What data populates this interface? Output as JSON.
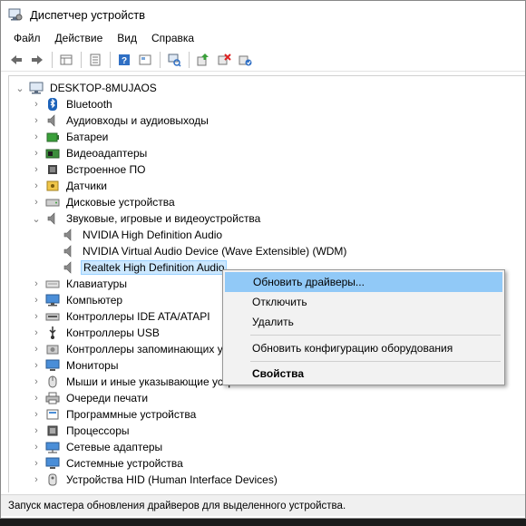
{
  "window": {
    "title": "Диспетчер устройств"
  },
  "menu": [
    "Файл",
    "Действие",
    "Вид",
    "Справка"
  ],
  "toolbar": {
    "icons": [
      "back-arrow-icon",
      "forward-arrow-icon",
      "properties-grid-icon",
      "device-list-icon",
      "help-icon",
      "resources-icon",
      "scan-hardware-icon",
      "update-driver-icon",
      "uninstall-device-icon",
      "enable-device-icon"
    ]
  },
  "tree": {
    "root": "DESKTOP-8MUJAOS",
    "items": [
      {
        "label": "Bluetooth",
        "icon": "bluetooth-icon",
        "expanded": false
      },
      {
        "label": "Аудиовходы и аудиовыходы",
        "icon": "speaker-icon",
        "expanded": false
      },
      {
        "label": "Батареи",
        "icon": "battery-icon",
        "expanded": false
      },
      {
        "label": "Видеоадаптеры",
        "icon": "display-adapter-icon",
        "expanded": false
      },
      {
        "label": "Встроенное ПО",
        "icon": "firmware-icon",
        "expanded": false
      },
      {
        "label": "Датчики",
        "icon": "sensor-icon",
        "expanded": false
      },
      {
        "label": "Дисковые устройства",
        "icon": "disk-drive-icon",
        "expanded": false
      },
      {
        "label": "Звуковые, игровые и видеоустройства",
        "icon": "speaker-icon",
        "expanded": true
      },
      {
        "label": "NVIDIA High Definition Audio",
        "icon": "speaker-icon",
        "child": true
      },
      {
        "label": "NVIDIA Virtual Audio Device (Wave Extensible) (WDM)",
        "icon": "speaker-icon",
        "child": true
      },
      {
        "label": "Realtek High Definition Audio",
        "icon": "speaker-icon",
        "child": true,
        "selected": true
      },
      {
        "label": "Клавиатуры",
        "icon": "keyboard-icon",
        "expanded": false
      },
      {
        "label": "Компьютер",
        "icon": "computer-icon",
        "expanded": false
      },
      {
        "label": "Контроллеры IDE ATA/ATAPI",
        "icon": "ide-controller-icon",
        "expanded": false
      },
      {
        "label": "Контроллеры USB",
        "icon": "usb-icon",
        "expanded": false
      },
      {
        "label": "Контроллеры запоминающих устройств",
        "icon": "storage-controller-icon",
        "expanded": false
      },
      {
        "label": "Мониторы",
        "icon": "monitor-icon",
        "expanded": false
      },
      {
        "label": "Мыши и иные указывающие устройства",
        "icon": "mouse-icon",
        "expanded": false
      },
      {
        "label": "Очереди печати",
        "icon": "printer-icon",
        "expanded": false
      },
      {
        "label": "Программные устройства",
        "icon": "software-device-icon",
        "expanded": false
      },
      {
        "label": "Процессоры",
        "icon": "processor-icon",
        "expanded": false
      },
      {
        "label": "Сетевые адаптеры",
        "icon": "network-adapter-icon",
        "expanded": false
      },
      {
        "label": "Системные устройства",
        "icon": "system-device-icon",
        "expanded": false
      },
      {
        "label": "Устройства HID (Human Interface Devices)",
        "icon": "hid-icon",
        "expanded": false
      }
    ]
  },
  "context_menu": {
    "update": "Обновить драйверы...",
    "disable": "Отключить",
    "remove": "Удалить",
    "scan": "Обновить конфигурацию оборудования",
    "properties": "Свойства"
  },
  "status": "Запуск мастера обновления драйверов для выделенного устройства.",
  "colors": {
    "selection": "#cce8ff",
    "menu_highlight": "#91c9f7",
    "status_bg": "#f0f0f0"
  }
}
